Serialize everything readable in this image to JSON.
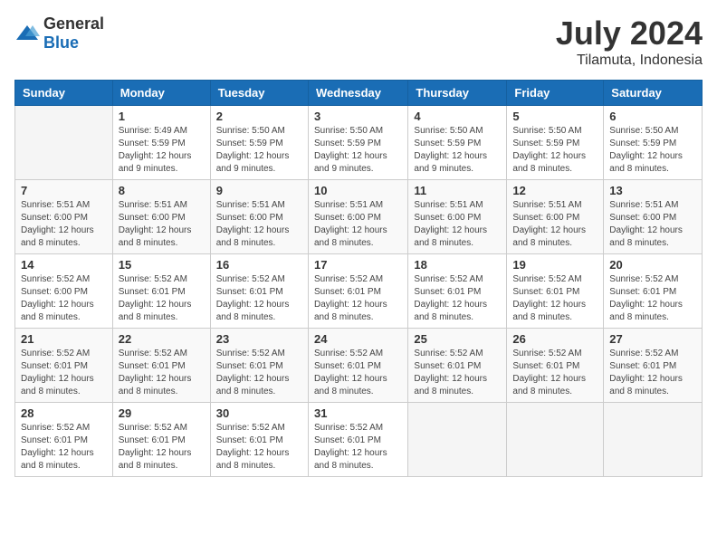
{
  "header": {
    "logo": {
      "general": "General",
      "blue": "Blue"
    },
    "title": "July 2024",
    "location": "Tilamuta, Indonesia"
  },
  "calendar": {
    "weekdays": [
      "Sunday",
      "Monday",
      "Tuesday",
      "Wednesday",
      "Thursday",
      "Friday",
      "Saturday"
    ],
    "weeks": [
      [
        {
          "day": "",
          "sunrise": "",
          "sunset": "",
          "daylight": ""
        },
        {
          "day": "1",
          "sunrise": "Sunrise: 5:49 AM",
          "sunset": "Sunset: 5:59 PM",
          "daylight": "Daylight: 12 hours and 9 minutes."
        },
        {
          "day": "2",
          "sunrise": "Sunrise: 5:50 AM",
          "sunset": "Sunset: 5:59 PM",
          "daylight": "Daylight: 12 hours and 9 minutes."
        },
        {
          "day": "3",
          "sunrise": "Sunrise: 5:50 AM",
          "sunset": "Sunset: 5:59 PM",
          "daylight": "Daylight: 12 hours and 9 minutes."
        },
        {
          "day": "4",
          "sunrise": "Sunrise: 5:50 AM",
          "sunset": "Sunset: 5:59 PM",
          "daylight": "Daylight: 12 hours and 9 minutes."
        },
        {
          "day": "5",
          "sunrise": "Sunrise: 5:50 AM",
          "sunset": "Sunset: 5:59 PM",
          "daylight": "Daylight: 12 hours and 8 minutes."
        },
        {
          "day": "6",
          "sunrise": "Sunrise: 5:50 AM",
          "sunset": "Sunset: 5:59 PM",
          "daylight": "Daylight: 12 hours and 8 minutes."
        }
      ],
      [
        {
          "day": "7",
          "sunrise": "Sunrise: 5:51 AM",
          "sunset": "Sunset: 6:00 PM",
          "daylight": "Daylight: 12 hours and 8 minutes."
        },
        {
          "day": "8",
          "sunrise": "Sunrise: 5:51 AM",
          "sunset": "Sunset: 6:00 PM",
          "daylight": "Daylight: 12 hours and 8 minutes."
        },
        {
          "day": "9",
          "sunrise": "Sunrise: 5:51 AM",
          "sunset": "Sunset: 6:00 PM",
          "daylight": "Daylight: 12 hours and 8 minutes."
        },
        {
          "day": "10",
          "sunrise": "Sunrise: 5:51 AM",
          "sunset": "Sunset: 6:00 PM",
          "daylight": "Daylight: 12 hours and 8 minutes."
        },
        {
          "day": "11",
          "sunrise": "Sunrise: 5:51 AM",
          "sunset": "Sunset: 6:00 PM",
          "daylight": "Daylight: 12 hours and 8 minutes."
        },
        {
          "day": "12",
          "sunrise": "Sunrise: 5:51 AM",
          "sunset": "Sunset: 6:00 PM",
          "daylight": "Daylight: 12 hours and 8 minutes."
        },
        {
          "day": "13",
          "sunrise": "Sunrise: 5:51 AM",
          "sunset": "Sunset: 6:00 PM",
          "daylight": "Daylight: 12 hours and 8 minutes."
        }
      ],
      [
        {
          "day": "14",
          "sunrise": "Sunrise: 5:52 AM",
          "sunset": "Sunset: 6:00 PM",
          "daylight": "Daylight: 12 hours and 8 minutes."
        },
        {
          "day": "15",
          "sunrise": "Sunrise: 5:52 AM",
          "sunset": "Sunset: 6:01 PM",
          "daylight": "Daylight: 12 hours and 8 minutes."
        },
        {
          "day": "16",
          "sunrise": "Sunrise: 5:52 AM",
          "sunset": "Sunset: 6:01 PM",
          "daylight": "Daylight: 12 hours and 8 minutes."
        },
        {
          "day": "17",
          "sunrise": "Sunrise: 5:52 AM",
          "sunset": "Sunset: 6:01 PM",
          "daylight": "Daylight: 12 hours and 8 minutes."
        },
        {
          "day": "18",
          "sunrise": "Sunrise: 5:52 AM",
          "sunset": "Sunset: 6:01 PM",
          "daylight": "Daylight: 12 hours and 8 minutes."
        },
        {
          "day": "19",
          "sunrise": "Sunrise: 5:52 AM",
          "sunset": "Sunset: 6:01 PM",
          "daylight": "Daylight: 12 hours and 8 minutes."
        },
        {
          "day": "20",
          "sunrise": "Sunrise: 5:52 AM",
          "sunset": "Sunset: 6:01 PM",
          "daylight": "Daylight: 12 hours and 8 minutes."
        }
      ],
      [
        {
          "day": "21",
          "sunrise": "Sunrise: 5:52 AM",
          "sunset": "Sunset: 6:01 PM",
          "daylight": "Daylight: 12 hours and 8 minutes."
        },
        {
          "day": "22",
          "sunrise": "Sunrise: 5:52 AM",
          "sunset": "Sunset: 6:01 PM",
          "daylight": "Daylight: 12 hours and 8 minutes."
        },
        {
          "day": "23",
          "sunrise": "Sunrise: 5:52 AM",
          "sunset": "Sunset: 6:01 PM",
          "daylight": "Daylight: 12 hours and 8 minutes."
        },
        {
          "day": "24",
          "sunrise": "Sunrise: 5:52 AM",
          "sunset": "Sunset: 6:01 PM",
          "daylight": "Daylight: 12 hours and 8 minutes."
        },
        {
          "day": "25",
          "sunrise": "Sunrise: 5:52 AM",
          "sunset": "Sunset: 6:01 PM",
          "daylight": "Daylight: 12 hours and 8 minutes."
        },
        {
          "day": "26",
          "sunrise": "Sunrise: 5:52 AM",
          "sunset": "Sunset: 6:01 PM",
          "daylight": "Daylight: 12 hours and 8 minutes."
        },
        {
          "day": "27",
          "sunrise": "Sunrise: 5:52 AM",
          "sunset": "Sunset: 6:01 PM",
          "daylight": "Daylight: 12 hours and 8 minutes."
        }
      ],
      [
        {
          "day": "28",
          "sunrise": "Sunrise: 5:52 AM",
          "sunset": "Sunset: 6:01 PM",
          "daylight": "Daylight: 12 hours and 8 minutes."
        },
        {
          "day": "29",
          "sunrise": "Sunrise: 5:52 AM",
          "sunset": "Sunset: 6:01 PM",
          "daylight": "Daylight: 12 hours and 8 minutes."
        },
        {
          "day": "30",
          "sunrise": "Sunrise: 5:52 AM",
          "sunset": "Sunset: 6:01 PM",
          "daylight": "Daylight: 12 hours and 8 minutes."
        },
        {
          "day": "31",
          "sunrise": "Sunrise: 5:52 AM",
          "sunset": "Sunset: 6:01 PM",
          "daylight": "Daylight: 12 hours and 8 minutes."
        },
        {
          "day": "",
          "sunrise": "",
          "sunset": "",
          "daylight": ""
        },
        {
          "day": "",
          "sunrise": "",
          "sunset": "",
          "daylight": ""
        },
        {
          "day": "",
          "sunrise": "",
          "sunset": "",
          "daylight": ""
        }
      ]
    ]
  }
}
